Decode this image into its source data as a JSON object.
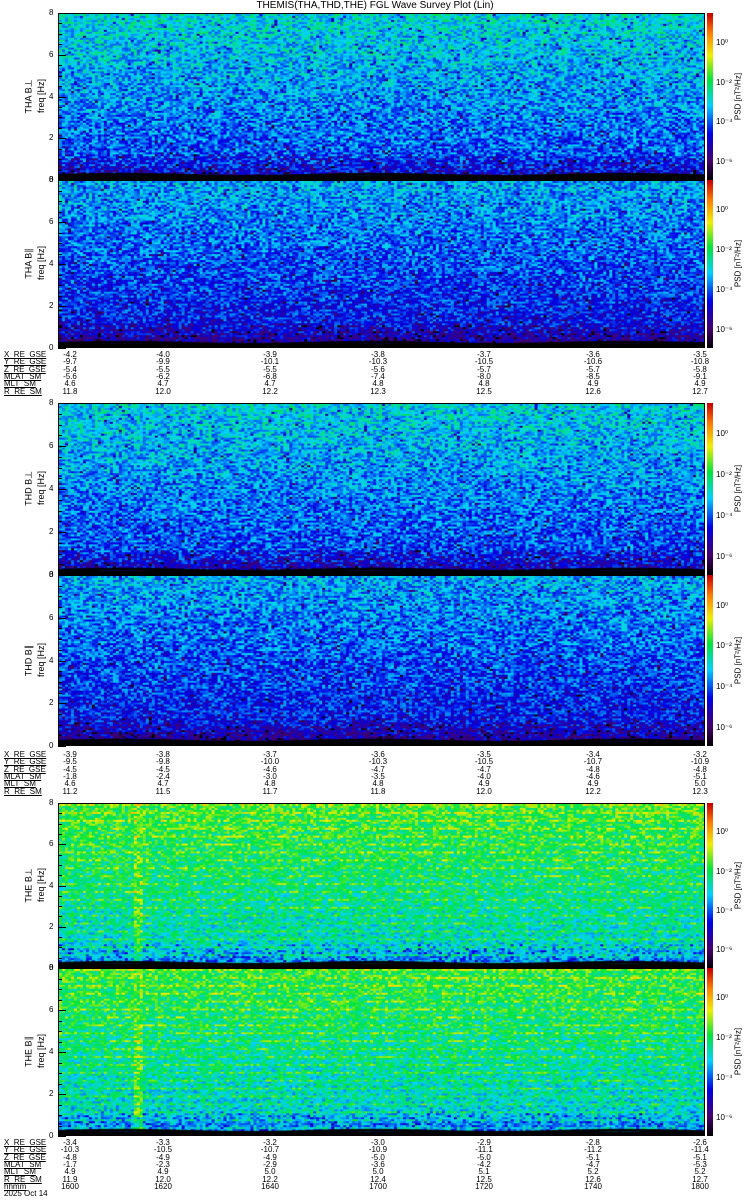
{
  "title": "THEMIS(THA,THD,THE) FGL Wave Survey Plot (Lin)",
  "chart_data": {
    "type": "heatmap",
    "title": "THEMIS(THA,THD,THE) FGL Wave Survey Plot (Lin)",
    "xlabel": "hhmm",
    "date": "2025 Oct 14",
    "ylim": [
      0,
      8
    ],
    "y_ticks": [
      "0",
      "2",
      "4",
      "6",
      "8"
    ],
    "y_unit_label": "freq [Hz]",
    "colorbar": {
      "label": "PSD [nT²/Hz]",
      "scale": "log",
      "ticks": [
        "10⁰",
        "10⁻²",
        "10⁻⁴",
        "10⁻⁶"
      ],
      "tick_exponents": [
        0,
        -2,
        -4,
        -6
      ],
      "range_exponent": [
        -6.9,
        1.5
      ],
      "colormap": "rainbow"
    },
    "panels": [
      {
        "label": "THA B⊥",
        "probe": "THA",
        "component": "perp",
        "typical_log_psd": -3.5
      },
      {
        "label": "THA B∥",
        "probe": "THA",
        "component": "par",
        "typical_log_psd": -4.0
      },
      {
        "label": "THD B⊥",
        "probe": "THD",
        "component": "perp",
        "typical_log_psd": -3.6
      },
      {
        "label": "THD B∥",
        "probe": "THD",
        "component": "par",
        "typical_log_psd": -4.0
      },
      {
        "label": "THE B⊥",
        "probe": "THE",
        "component": "perp",
        "typical_log_psd": -2.3
      },
      {
        "label": "THE B∥",
        "probe": "THE",
        "component": "par",
        "typical_log_psd": -2.4
      }
    ]
  },
  "orbit_tables": [
    {
      "rows": [
        {
          "label": "X_RE_GSE",
          "values": [
            "-4.2",
            "-4.0",
            "-3.9",
            "-3.8",
            "-3.7",
            "-3.6",
            "-3.5"
          ]
        },
        {
          "label": "Y_RE_GSE",
          "values": [
            "-9.7",
            "-9.9",
            "-10.1",
            "-10.3",
            "-10.5",
            "-10.6",
            "-10.8"
          ]
        },
        {
          "label": "Z_RE_GSE",
          "values": [
            "-5.4",
            "-5.5",
            "-5.5",
            "-5.6",
            "-5.7",
            "-5.7",
            "-5.8"
          ]
        },
        {
          "label": "MLAT_SM",
          "values": [
            "-5.6",
            "-6.2",
            "-6.8",
            "-7.4",
            "-8.0",
            "-8.5",
            "-9.1"
          ]
        },
        {
          "label": "MLT_SM",
          "values": [
            "4.6",
            "4.7",
            "4.7",
            "4.8",
            "4.8",
            "4.9",
            "4.9"
          ]
        },
        {
          "label": "R_RE_SM",
          "values": [
            "11.8",
            "12.0",
            "12.2",
            "12.3",
            "12.5",
            "12.6",
            "12.7"
          ]
        }
      ]
    },
    {
      "rows": [
        {
          "label": "X_RE_GSE",
          "values": [
            "-3.9",
            "-3.8",
            "-3.7",
            "-3.6",
            "-3.5",
            "-3.4",
            "-3.2"
          ]
        },
        {
          "label": "Y_RE_GSE",
          "values": [
            "-9.5",
            "-9.8",
            "-10.0",
            "-10.3",
            "-10.5",
            "-10.7",
            "-10.9"
          ]
        },
        {
          "label": "Z_RE_GSE",
          "values": [
            "-4.5",
            "-4.5",
            "-4.6",
            "-4.7",
            "-4.7",
            "-4.8",
            "-4.8"
          ]
        },
        {
          "label": "MLAT_SM",
          "values": [
            "-1.8",
            "-2.4",
            "-3.0",
            "-3.5",
            "-4.0",
            "-4.6",
            "-5.1"
          ]
        },
        {
          "label": "MLT_SM",
          "values": [
            "4.6",
            "4.7",
            "4.8",
            "4.8",
            "4.9",
            "4.9",
            "5.0"
          ]
        },
        {
          "label": "R_RE_SM",
          "values": [
            "11.2",
            "11.5",
            "11.7",
            "11.8",
            "12.0",
            "12.2",
            "12.3"
          ]
        }
      ]
    },
    {
      "rows": [
        {
          "label": "X_RE_GSE",
          "values": [
            "-3.4",
            "-3.3",
            "-3.2",
            "-3.0",
            "-2.9",
            "-2.8",
            "-2.6"
          ]
        },
        {
          "label": "Y_RE_GSE",
          "values": [
            "-10.3",
            "-10.5",
            "-10.7",
            "-10.9",
            "-11.1",
            "-11.2",
            "-11.4"
          ]
        },
        {
          "label": "Z_RE_GSE",
          "values": [
            "-4.8",
            "-4.9",
            "-4.9",
            "-5.0",
            "-5.0",
            "-5.1",
            "-5.1"
          ]
        },
        {
          "label": "MLAT_SM",
          "values": [
            "-1.7",
            "-2.3",
            "-2.9",
            "-3.6",
            "-4.2",
            "-4.7",
            "-5.3"
          ]
        },
        {
          "label": "MLT_SM",
          "values": [
            "4.9",
            "4.9",
            "5.0",
            "5.0",
            "5.1",
            "5.2",
            "5.2"
          ]
        },
        {
          "label": "R_RE_SM",
          "values": [
            "11.9",
            "12.0",
            "12.2",
            "12.4",
            "12.5",
            "12.6",
            "12.7"
          ]
        },
        {
          "label": "hhmm",
          "values": [
            "1600",
            "1620",
            "1640",
            "1700",
            "1720",
            "1740",
            "1800"
          ]
        }
      ],
      "date": "2025 Oct 14"
    }
  ]
}
